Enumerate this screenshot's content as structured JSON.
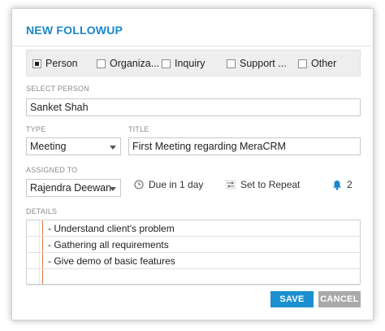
{
  "dialog": {
    "title": "NEW FOLLOWUP"
  },
  "related_types": [
    {
      "label": "Person",
      "checked": true
    },
    {
      "label": "Organiza...",
      "checked": false
    },
    {
      "label": "Inquiry",
      "checked": false
    },
    {
      "label": "Support ...",
      "checked": false
    },
    {
      "label": "Other",
      "checked": false
    }
  ],
  "select_person": {
    "label": "SELECT PERSON",
    "value": "Sanket Shah"
  },
  "type": {
    "label": "TYPE",
    "value": "Meeting"
  },
  "title_field": {
    "label": "TITLE",
    "value": "First Meeting regarding MeraCRM"
  },
  "assigned_to": {
    "label": "ASSIGNED TO",
    "value": "Rajendra Deewan"
  },
  "due": {
    "text": "Due in 1 day",
    "icon": "clock-icon"
  },
  "repeat": {
    "text": "Set to Repeat",
    "icon": "repeat-icon"
  },
  "reminders": {
    "count": "2",
    "icon": "bell-icon",
    "color": "#1b87c7"
  },
  "details": {
    "label": "DETAILS",
    "lines": [
      "- Understand client's problem",
      "- Gathering all requirements",
      "- Give demo of basic features"
    ]
  },
  "actions": {
    "save": "SAVE",
    "cancel": "CANCEL"
  },
  "colors": {
    "accent": "#1b87c7",
    "save_button": "#1b8fd0",
    "cancel_button": "#a9a9a9",
    "notes_margin": "#e07a3f"
  }
}
